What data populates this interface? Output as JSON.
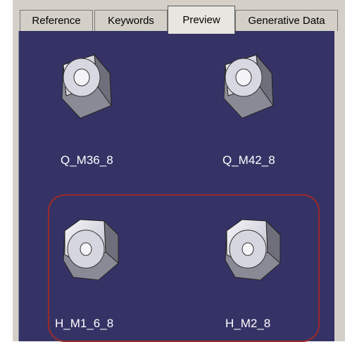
{
  "tabs": [
    {
      "label": "Reference",
      "active": false
    },
    {
      "label": "Keywords",
      "active": false
    },
    {
      "label": "Preview",
      "active": true
    },
    {
      "label": "Generative Data",
      "active": false
    }
  ],
  "items": [
    {
      "name": "Q_M36_8",
      "type": "square-nut"
    },
    {
      "name": "Q_M42_8",
      "type": "square-nut"
    },
    {
      "name": "H_M1_6_8",
      "type": "hex-nut"
    },
    {
      "name": "H_M2_8",
      "type": "hex-nut"
    }
  ],
  "colors": {
    "preview_background": "#353366",
    "highlight_outline": "#9a2a2a",
    "caption_text": "#ffffff"
  }
}
